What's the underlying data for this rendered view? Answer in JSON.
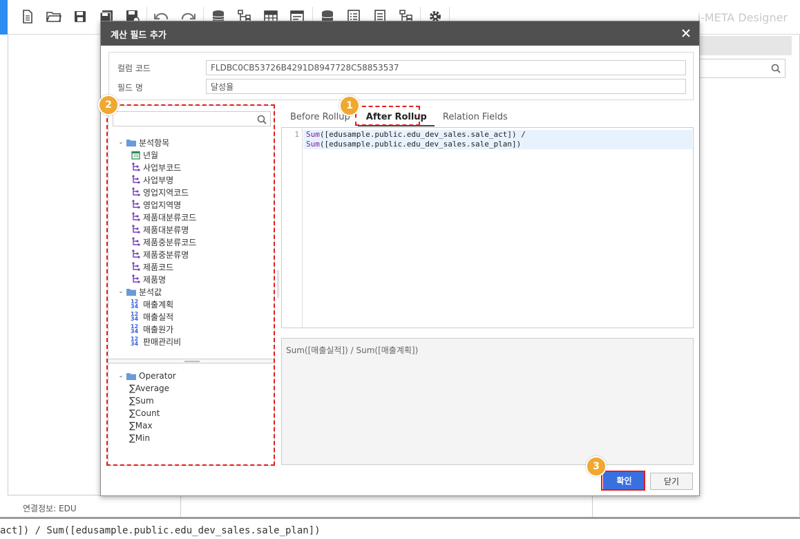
{
  "app": {
    "title": "i-META Designer",
    "status": "연결정보: EDU",
    "bottom_formula": "act]) / Sum([edusample.public.edu_dev_sales.sale_plan])"
  },
  "toolbar": {
    "icons": [
      "new-document-icon",
      "open-folder-icon",
      "save-icon",
      "save-as-icon",
      "save-close-icon",
      "undo-icon",
      "redo-icon",
      "database-icon",
      "hierarchy-icon",
      "table-icon",
      "form-icon",
      "datasource-icon",
      "report-icon",
      "document-icon",
      "structure-icon",
      "settings-gear-icon"
    ]
  },
  "dialog": {
    "title": "계산 필드 추가",
    "column_code_label": "컬럼 코드",
    "column_code_value": "FLDBC0CB53726B4291D8947728C58853537",
    "field_name_label": "필드 명",
    "field_name_value": "달성율",
    "tree": {
      "groups": [
        {
          "label": "분석항목",
          "items": [
            {
              "label": "년월",
              "icon": "calendar-icon"
            },
            {
              "label": "사업부코드",
              "icon": "dimension-icon"
            },
            {
              "label": "사업부명",
              "icon": "dimension-icon"
            },
            {
              "label": "영업지역코드",
              "icon": "dimension-icon"
            },
            {
              "label": "영업지역명",
              "icon": "dimension-icon"
            },
            {
              "label": "제품대분류코드",
              "icon": "dimension-icon"
            },
            {
              "label": "제품대분류명",
              "icon": "dimension-icon"
            },
            {
              "label": "제품중분류코드",
              "icon": "dimension-icon"
            },
            {
              "label": "제품중분류명",
              "icon": "dimension-icon"
            },
            {
              "label": "제품코드",
              "icon": "dimension-icon"
            },
            {
              "label": "제품명",
              "icon": "dimension-icon"
            }
          ]
        },
        {
          "label": "분석값",
          "items": [
            {
              "label": "매출계획",
              "icon": "numeric-measure-icon"
            },
            {
              "label": "매출실적",
              "icon": "numeric-measure-icon"
            },
            {
              "label": "매출원가",
              "icon": "numeric-measure-icon"
            },
            {
              "label": "판매관리비",
              "icon": "numeric-measure-icon"
            }
          ]
        }
      ]
    },
    "operators": {
      "label": "Operator",
      "items": [
        "Average",
        "Sum",
        "Count",
        "Max",
        "Min"
      ]
    },
    "tabs": [
      "Before Rollup",
      "After Rollup",
      "Relation Fields"
    ],
    "active_tab": "After Rollup",
    "editor": {
      "line_number": "1",
      "line1_fn": "Sum",
      "line1_rest": "([edusample.public.edu_dev_sales.sale_act]) /",
      "line2_fn": "Sum",
      "line2_rest": "([edusample.public.edu_dev_sales.sale_plan])"
    },
    "preview_text": "Sum([매출실적]) / Sum([매출계획])",
    "ok_label": "확인",
    "close_label": "닫기"
  },
  "annotations": {
    "badge_1": "1",
    "badge_2": "2",
    "badge_3": "3",
    "highlight_color": "#e01e1e",
    "badge_color": "#f0a830"
  }
}
